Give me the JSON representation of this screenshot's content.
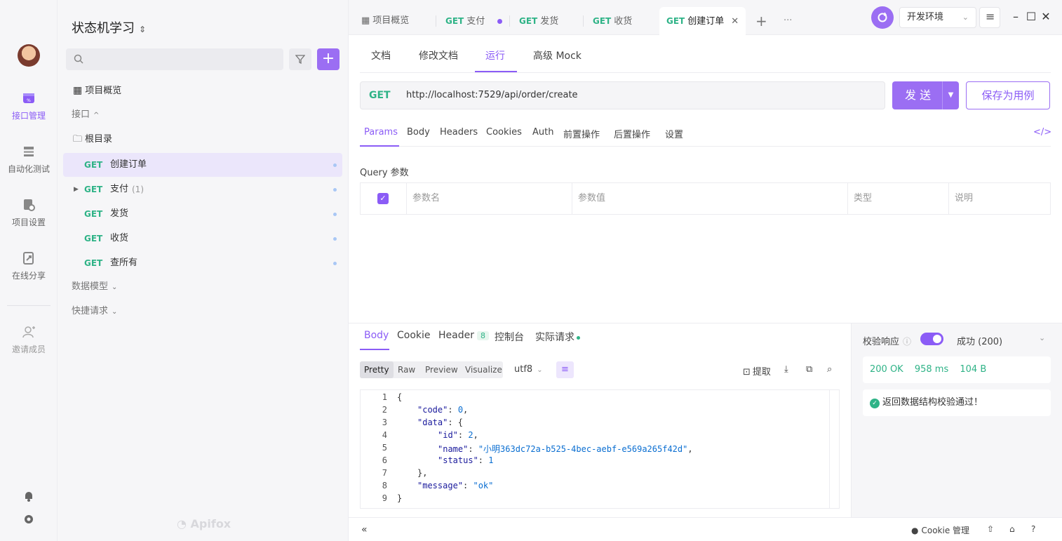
{
  "rail": {
    "items": [
      {
        "label": "接口管理"
      },
      {
        "label": "自动化测试"
      },
      {
        "label": "项目设置"
      },
      {
        "label": "在线分享"
      },
      {
        "label": "邀请成员"
      }
    ],
    "active_color": "#8b5cf6"
  },
  "sidebar": {
    "project_title": "状态机学习",
    "search_placeholder": "",
    "overview_label": "项目概览",
    "interfaces_label": "接口",
    "root_label": "根目录",
    "endpoints": [
      {
        "method": "GET",
        "name": "创建订单",
        "count": ""
      },
      {
        "method": "GET",
        "name": "支付",
        "count": "(1)"
      },
      {
        "method": "GET",
        "name": "发货",
        "count": ""
      },
      {
        "method": "GET",
        "name": "收货",
        "count": ""
      },
      {
        "method": "GET",
        "name": "查所有",
        "count": ""
      }
    ],
    "data_models_label": "数据模型",
    "quick_requests_label": "快捷请求",
    "brand": "Apifox"
  },
  "tabs": {
    "overview": "项目概览",
    "items": [
      {
        "method": "GET",
        "name": "支付"
      },
      {
        "method": "GET",
        "name": "发货"
      },
      {
        "method": "GET",
        "name": "收货"
      },
      {
        "method": "GET",
        "name": "创建订单"
      }
    ],
    "more": "···",
    "add": "+"
  },
  "env": {
    "selected": "开发环境"
  },
  "doc_tabs": [
    "文档",
    "修改文档",
    "运行",
    "高级 Mock"
  ],
  "request": {
    "method": "GET",
    "url": "http://localhost:7529/api/order/create",
    "send_label": "发 送",
    "save_label": "保存为用例",
    "tabs": [
      "Params",
      "Body",
      "Headers",
      "Cookies",
      "Auth",
      "前置操作",
      "后置操作",
      "设置"
    ],
    "query_label": "Query 参数",
    "columns": [
      "参数名",
      "参数值",
      "类型",
      "说明"
    ]
  },
  "response": {
    "tabs": [
      "Body",
      "Cookie",
      "Header",
      "控制台",
      "实际请求"
    ],
    "header_count": "8",
    "formats": [
      "Pretty",
      "Raw",
      "Preview",
      "Visualize"
    ],
    "encoding": "utf8",
    "extract_label": "提取",
    "lines": [
      "1",
      "2",
      "3",
      "4",
      "5",
      "6",
      "7",
      "8",
      "9"
    ],
    "code": {
      "l1": "{",
      "code_key": "\"code\"",
      "code_val": "0",
      "data_key": "\"data\"",
      "id_key": "\"id\"",
      "id_val": "2",
      "name_key": "\"name\"",
      "name_val": "\"小明363dc72a-b525-4bec-aebf-e569a265f42d\"",
      "status_key": "\"status\"",
      "status_val": "1",
      "msg_key": "\"message\"",
      "msg_val": "\"ok\""
    }
  },
  "validation": {
    "label": "校验响应",
    "status": "成功 (200)",
    "summary_status": "200 OK",
    "summary_time": "958 ms",
    "summary_size": "104 B",
    "message": "返回数据结构校验通过！"
  },
  "footer": {
    "cookie_label": "Cookie 管理"
  }
}
